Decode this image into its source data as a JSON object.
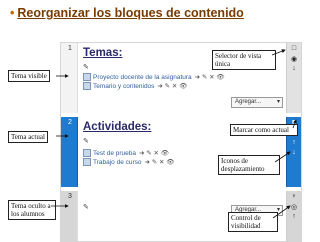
{
  "heading": {
    "bullet": "•",
    "text": "Reorganizar los bloques de contenido"
  },
  "blocks": [
    {
      "number": "1",
      "title": "Temas:",
      "items": [
        {
          "text": "Proyecto docente de la asignatura",
          "tools": "➜ ✎ ✕ 👁"
        },
        {
          "text": "Temario y contenidos",
          "tools": "➜ ✎ ✕ 👁"
        }
      ],
      "select_value": "Agregar..."
    },
    {
      "number": "2",
      "title": "Actividades:",
      "items": [
        {
          "text": "Test de prueba",
          "tools": "➜ ✎ ✕ 👁"
        },
        {
          "text": "Trabajo de curso",
          "tools": "➜ ✎ ✕ 👁"
        }
      ],
      "select_value": "Agregar..."
    },
    {
      "number": "3",
      "select_value": "Agregar..."
    }
  ],
  "callouts": {
    "selector_vista": "Selector de vista única",
    "tema_visible": "Tema visible",
    "tema_actual": "Tema actual",
    "marcar_actual": "Marcar como actual",
    "iconos_desplazamiento": "Iconos de desplazamiento",
    "tema_oculto": "Tema oculto a los alumnos",
    "control_visibilidad": "Control de visibilidad"
  },
  "icons": [
    "eye-icon",
    "arrow-up-icon",
    "arrow-down-icon",
    "square-icon",
    "lightbulb-icon"
  ],
  "colors": {
    "heading": "#7a3b00",
    "current_block": "#1f7bd0",
    "link": "#2f5fa0"
  }
}
